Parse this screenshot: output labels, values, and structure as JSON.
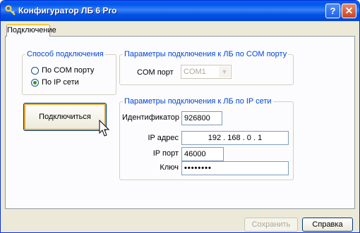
{
  "window": {
    "title": "Конфигуратор ЛБ 6 Pro"
  },
  "titlebar_buttons": {
    "help": "?",
    "close": "✕"
  },
  "tabs": [
    {
      "label": "Подключение",
      "active": true
    }
  ],
  "connection_method": {
    "legend": "Способ подключения",
    "options": [
      {
        "label": "По COM порту",
        "checked": false
      },
      {
        "label": "По IP сети",
        "checked": true
      }
    ]
  },
  "com_params": {
    "legend": "Параметры подключения к ЛБ по COM порту",
    "port_label": "COM порт",
    "port_value": "COM1"
  },
  "ip_params": {
    "legend": "Параметры подключения к ЛБ по IP сети",
    "id_label": "Идентификатор",
    "id_value": "926800",
    "ip_label": "IP адрес",
    "ip_value": "192 . 168 . 0 . 1",
    "port_label": "IP порт",
    "port_value": "46000",
    "key_label": "Ключ",
    "key_value": "••••••••"
  },
  "buttons": {
    "connect": "Подключиться",
    "save": "Сохранить",
    "help": "Справка"
  }
}
